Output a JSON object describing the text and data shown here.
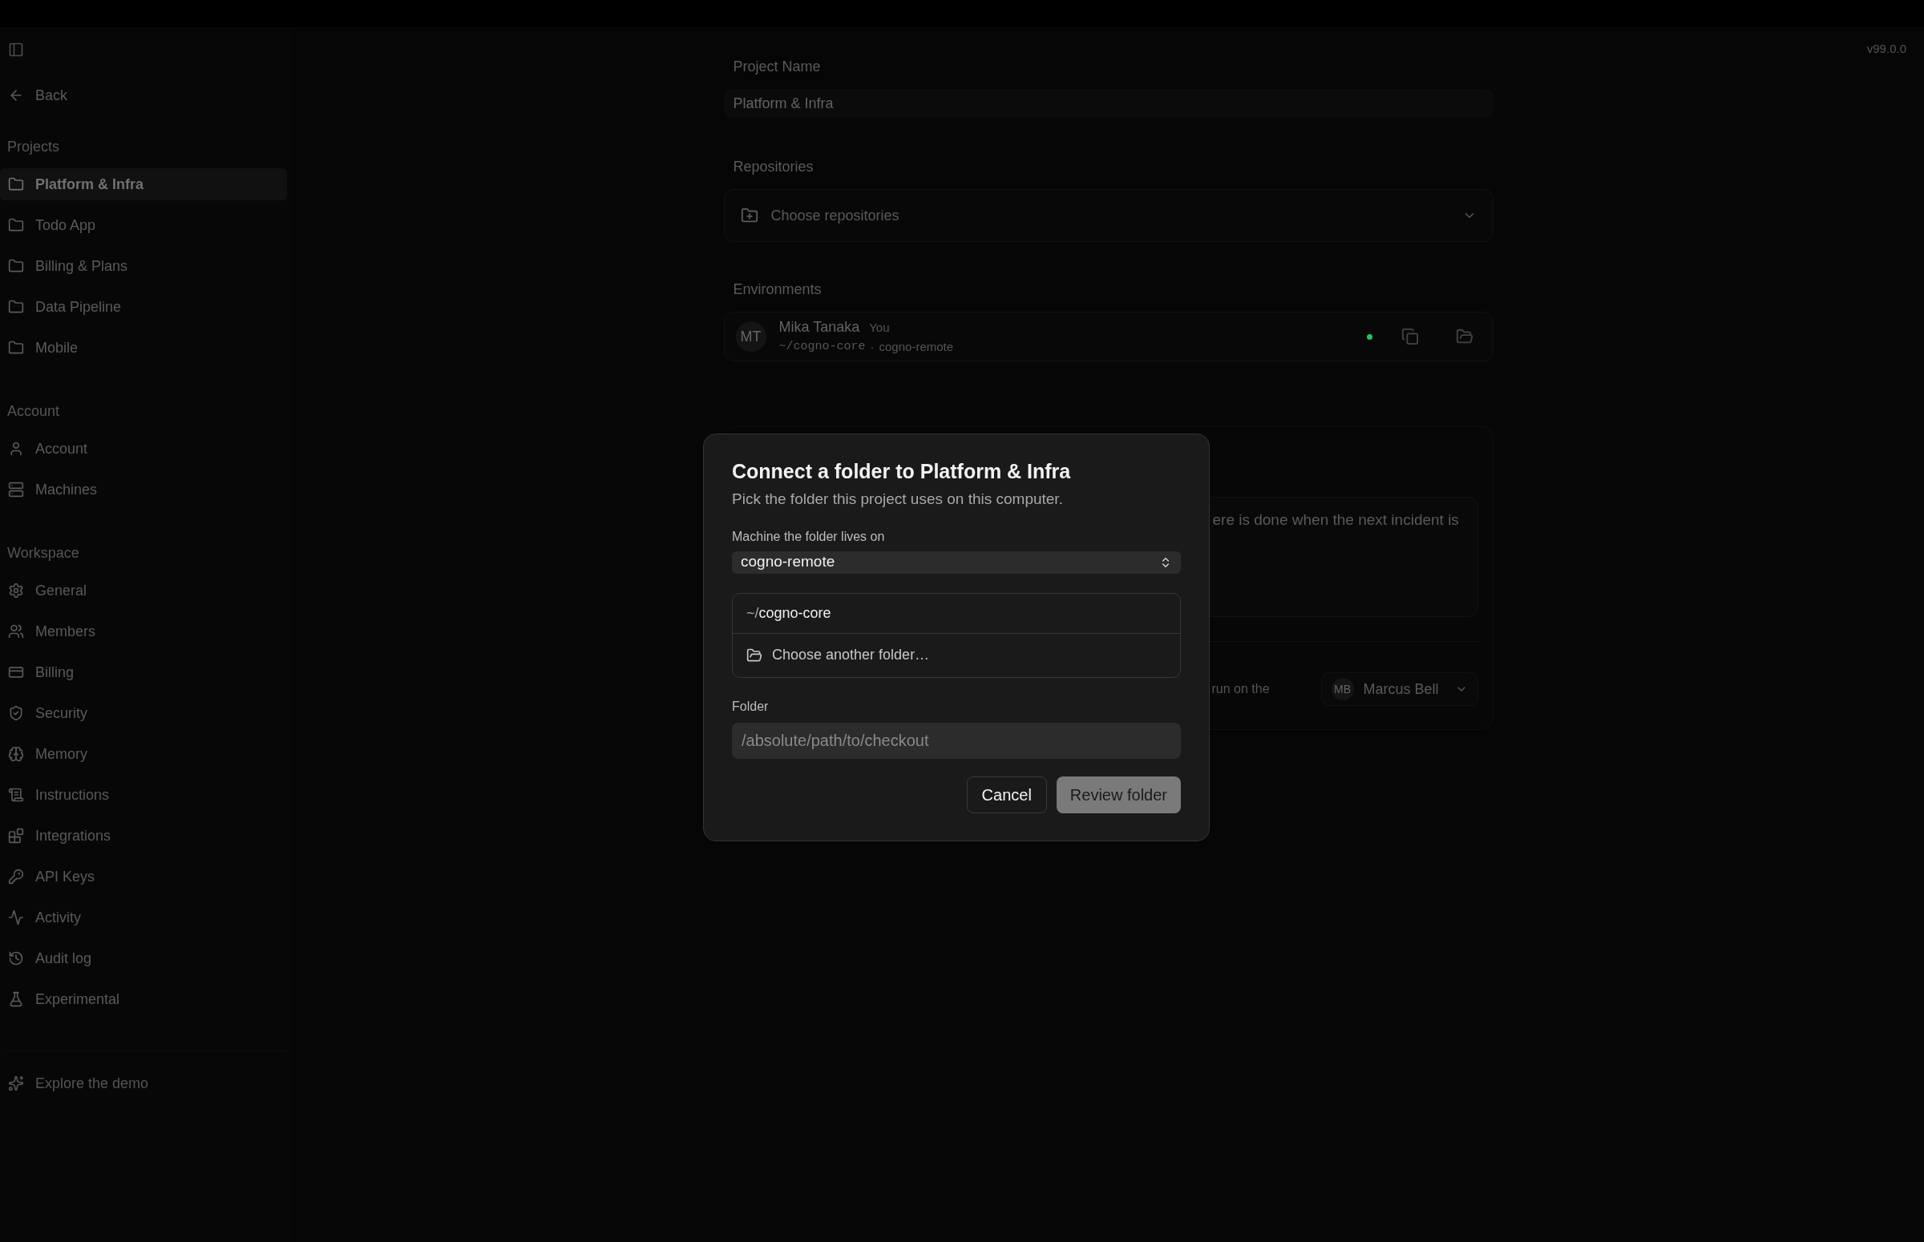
{
  "top_bar": {
    "version": "v99.0.0"
  },
  "sidebar": {
    "back": "Back",
    "groups": [
      {
        "title": "Projects",
        "items": [
          {
            "label": "Platform & Infra",
            "selected": true
          },
          {
            "label": "Todo App",
            "selected": false
          },
          {
            "label": "Billing & Plans",
            "selected": false
          },
          {
            "label": "Data Pipeline",
            "selected": false
          },
          {
            "label": "Mobile",
            "selected": false
          }
        ]
      },
      {
        "title": "Account",
        "items": [
          {
            "label": "Account",
            "selected": false
          },
          {
            "label": "Machines",
            "selected": false
          }
        ]
      },
      {
        "title": "Workspace",
        "items": [
          {
            "label": "General",
            "selected": false
          },
          {
            "label": "Members",
            "selected": false
          },
          {
            "label": "Billing",
            "selected": false
          },
          {
            "label": "Security",
            "selected": false
          },
          {
            "label": "Memory",
            "selected": false
          },
          {
            "label": "Instructions",
            "selected": false
          },
          {
            "label": "Integrations",
            "selected": false
          },
          {
            "label": "API Keys",
            "selected": false
          },
          {
            "label": "Activity",
            "selected": false
          },
          {
            "label": "Audit log",
            "selected": false
          },
          {
            "label": "Experimental",
            "selected": false
          }
        ]
      }
    ],
    "footer_link": "Explore the demo"
  },
  "project": {
    "name_label": "Project Name",
    "name_value": "Platform & Infra",
    "repositories_label": "Repositories",
    "repositories_placeholder": "Choose repositories",
    "environments_label": "Environments",
    "environments": [
      {
        "initials": "MT",
        "name": "Mika Tanaka",
        "badge": "You",
        "path": "~/cogno-core",
        "separator": "·",
        "machine": "cogno-remote",
        "color": "#22c55e"
      }
    ],
    "instructions_text": "ere is done when the next incident is",
    "run_text": "run on the",
    "assignee": {
      "initials": "MB",
      "name": "Marcus Bell"
    }
  },
  "dialog": {
    "title": "Connect a folder to Platform & Infra",
    "subtitle": "Pick the folder this project uses on this computer.",
    "machine_label": "Machine the folder lives on",
    "machine_value": "cogno-remote",
    "folders": [
      {
        "prefix": "~/",
        "name": "cogno-core"
      }
    ],
    "choose_other": "Choose another folder…",
    "folder_label": "Folder",
    "folder_placeholder": "/absolute/path/to/checkout",
    "cancel": "Cancel",
    "confirm": {
      "label": "Review folder",
      "disabled": true
    }
  }
}
